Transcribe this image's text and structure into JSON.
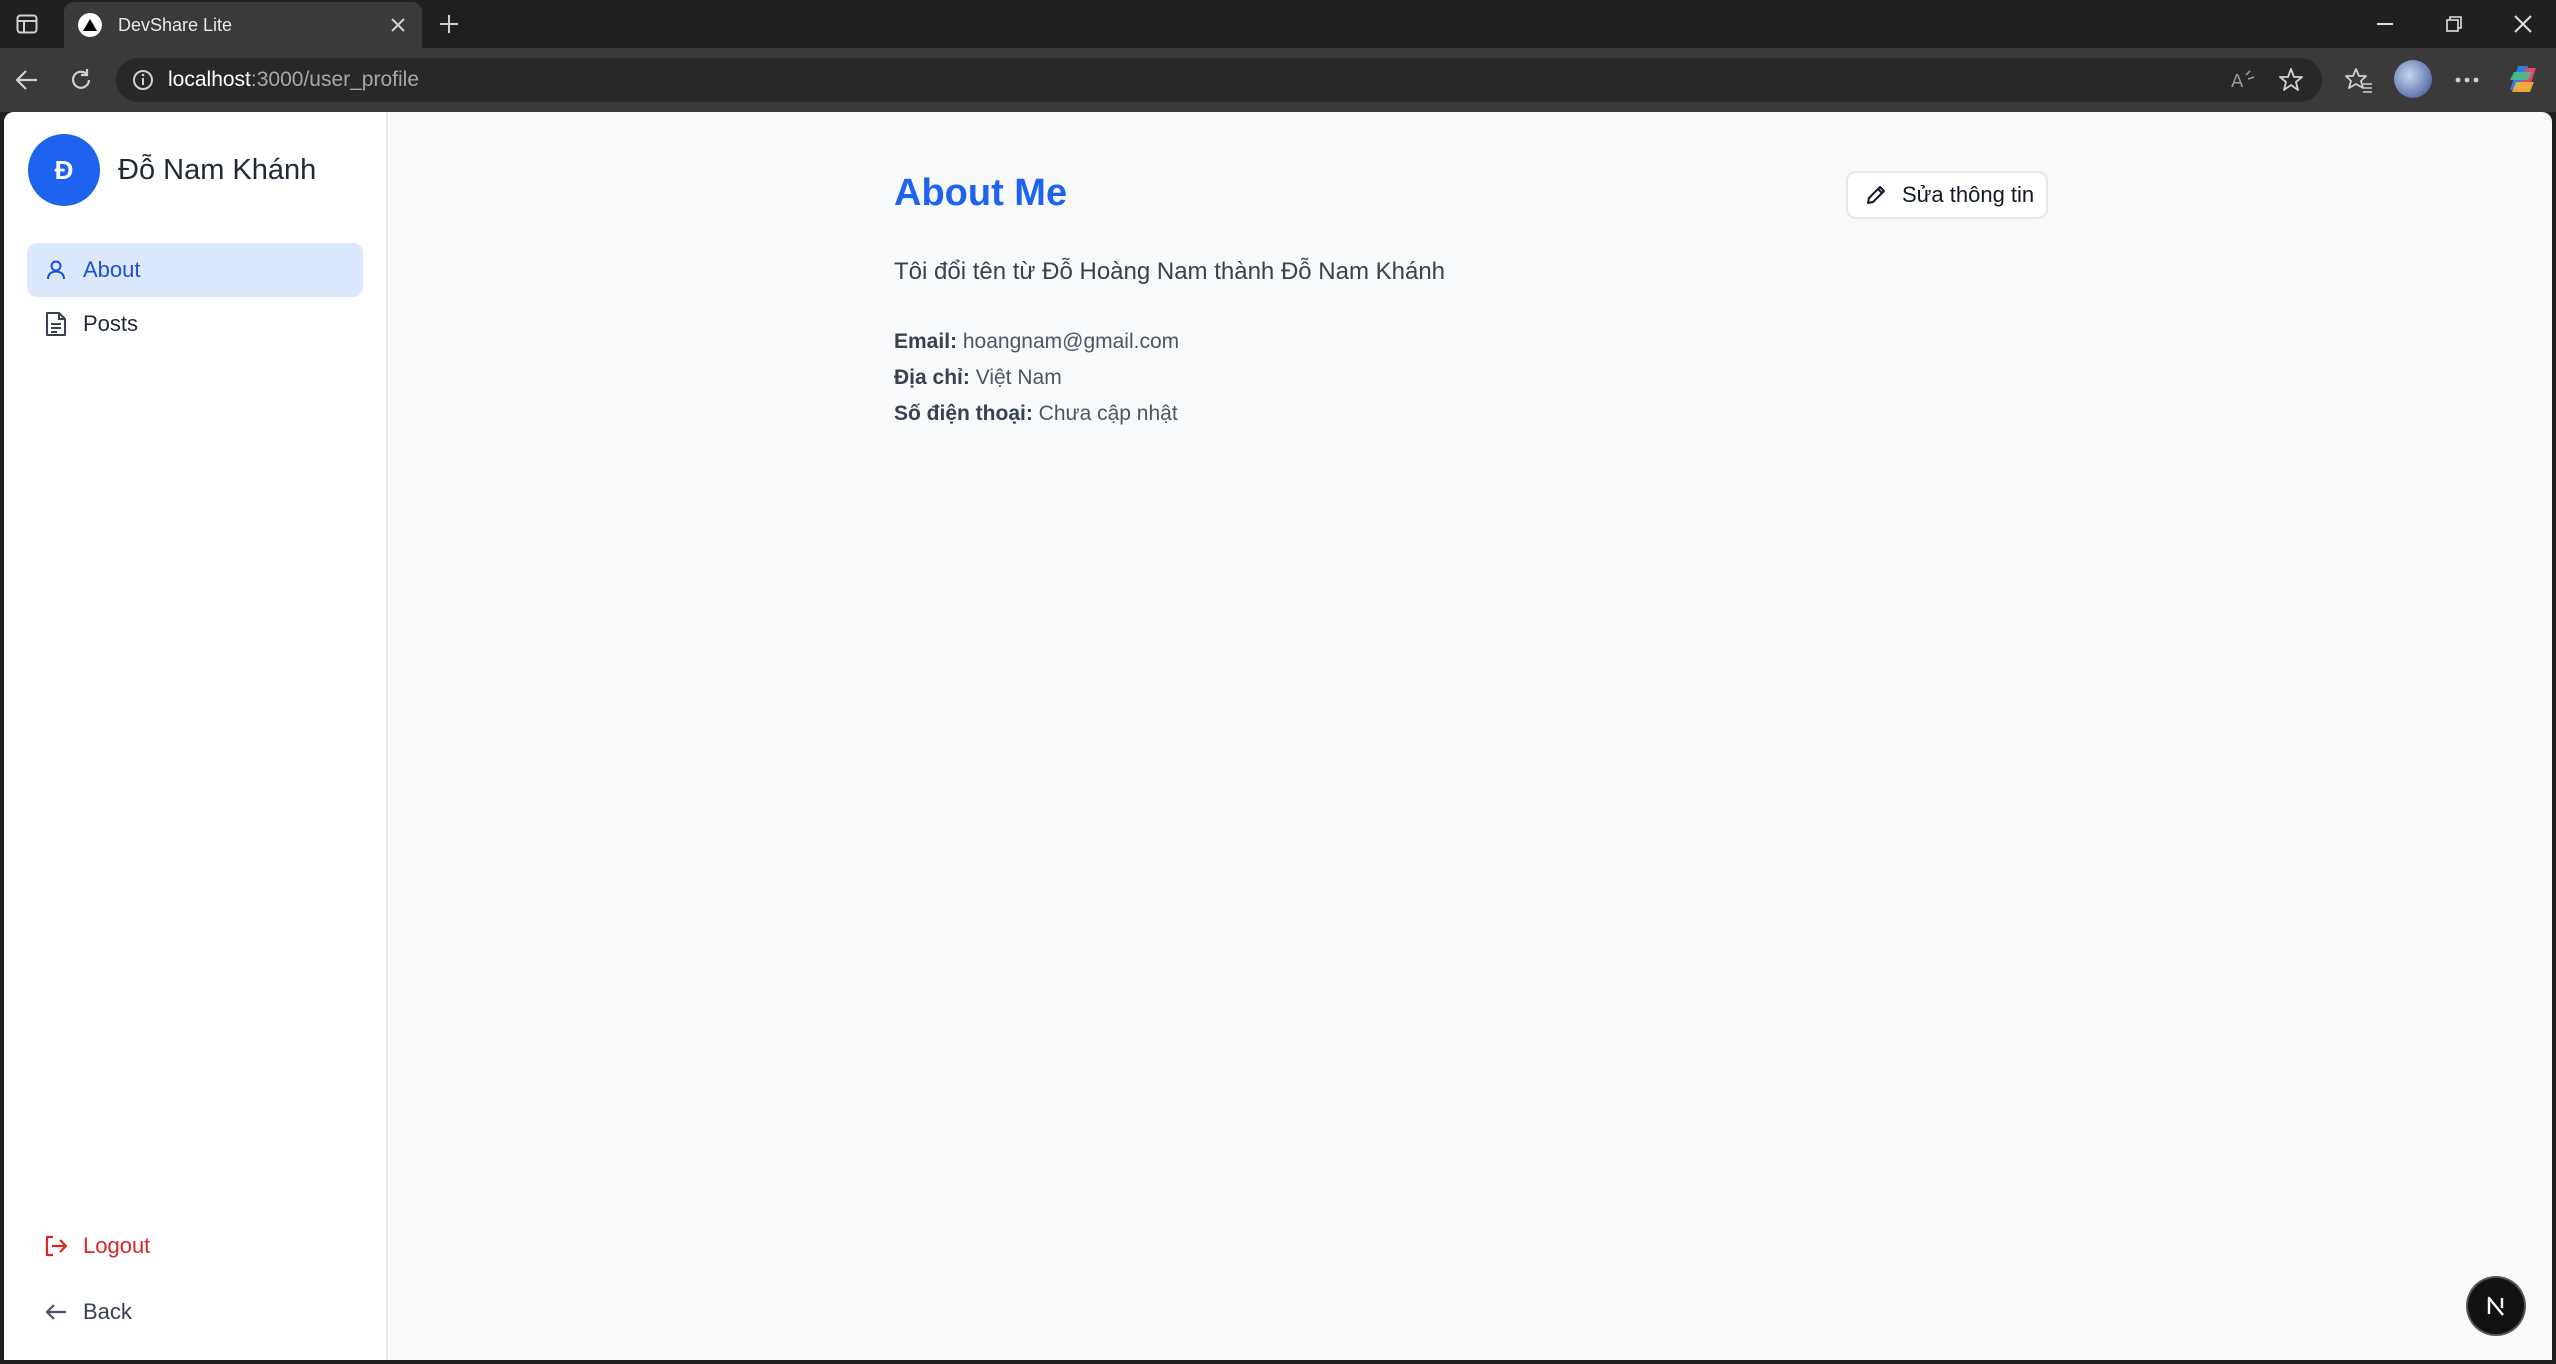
{
  "browser": {
    "tab_title": "DevShare Lite",
    "address_host": "localhost",
    "address_path": ":3000/user_profile",
    "icons": [
      "sidebar-toggle-icon",
      "close-icon",
      "plus-icon",
      "minimize-icon",
      "restore-icon",
      "close-window-icon",
      "back-arrow-icon",
      "reload-icon",
      "info-icon",
      "read-aloud-icon",
      "star-icon",
      "favorites-icon",
      "profile-avatar",
      "more-icon",
      "copilot-icon"
    ]
  },
  "sidebar": {
    "avatar_initial": "Đ",
    "username": "Đỗ Nam Khánh",
    "items": [
      {
        "label": "About",
        "icon": "user-icon",
        "active": true
      },
      {
        "label": "Posts",
        "icon": "document-icon",
        "active": false
      }
    ],
    "logout_label": "Logout",
    "back_label": "Back"
  },
  "main": {
    "title": "About Me",
    "edit_button_label": "Sửa thông tin",
    "bio": "Tôi đổi tên từ Đỗ Hoàng Nam thành Đỗ Nam Khánh",
    "fields": [
      {
        "label": "Email:",
        "value": "hoangnam@gmail.com"
      },
      {
        "label": "Địa chỉ:",
        "value": "Việt Nam"
      },
      {
        "label": "Số điện thoại:",
        "value": "Chưa cập nhật"
      }
    ]
  },
  "badge": {
    "letter": "N"
  },
  "colors": {
    "accent": "#1d63f0",
    "active_bg": "#dbe8fd",
    "logout": "#dc2626"
  }
}
